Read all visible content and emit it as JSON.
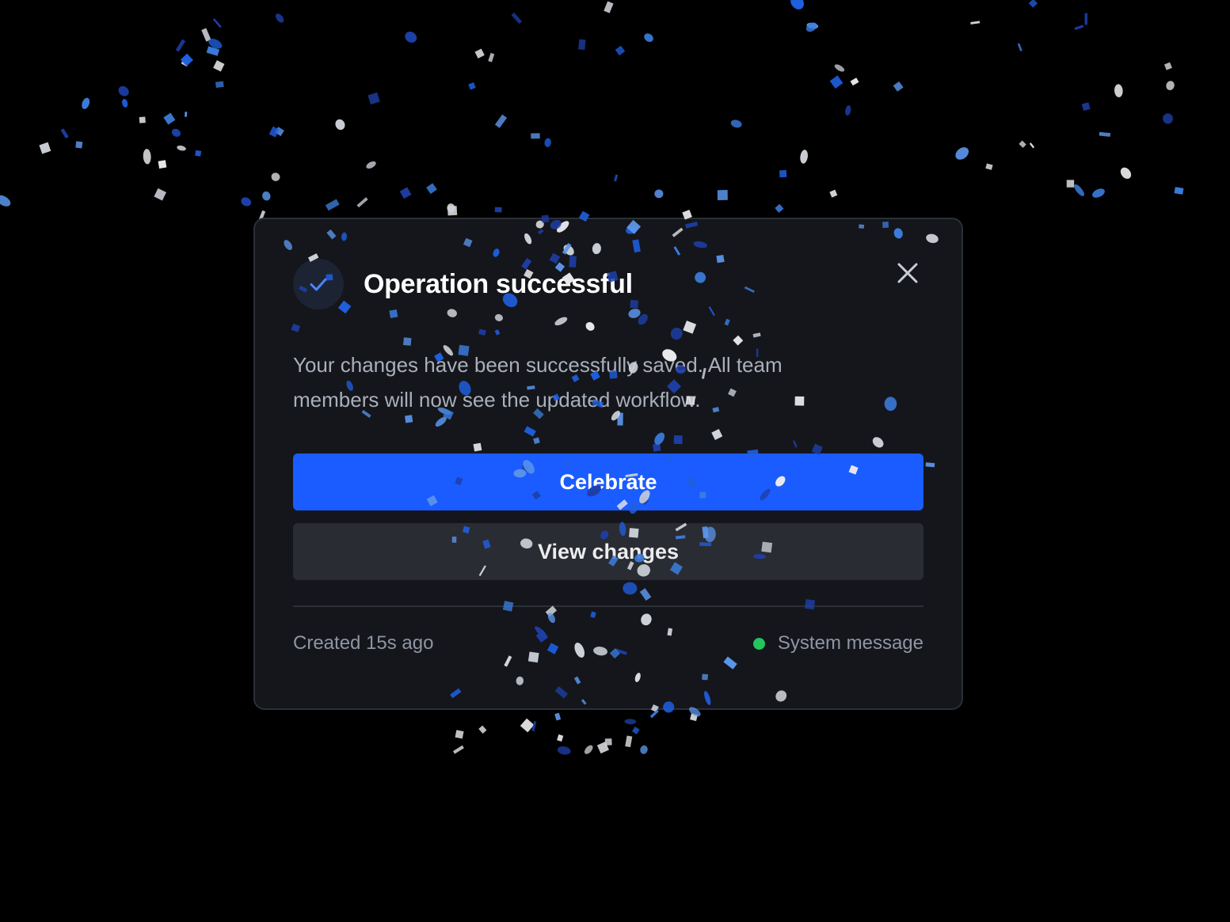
{
  "dialog": {
    "title": "Operation successful",
    "message": "Your changes have been successfully saved. All team members will now see the updated workflow.",
    "primary_button": "Celebrate",
    "secondary_button": "View changes",
    "created": "Created 15s ago",
    "source": "System message"
  },
  "icons": {
    "status": "checkmark-icon",
    "close": "close-icon",
    "indicator": "status-dot"
  },
  "colors": {
    "background": "#000000",
    "dialog_bg": "#14161b",
    "accent": "#1a5cff",
    "check": "#4d84ff",
    "status_dot": "#22c55e",
    "confetti": [
      "#1f5fe0",
      "#3b7ddd",
      "#5b95ea",
      "#1e3fa8",
      "#e9e9ec",
      "#cfd3da"
    ]
  }
}
